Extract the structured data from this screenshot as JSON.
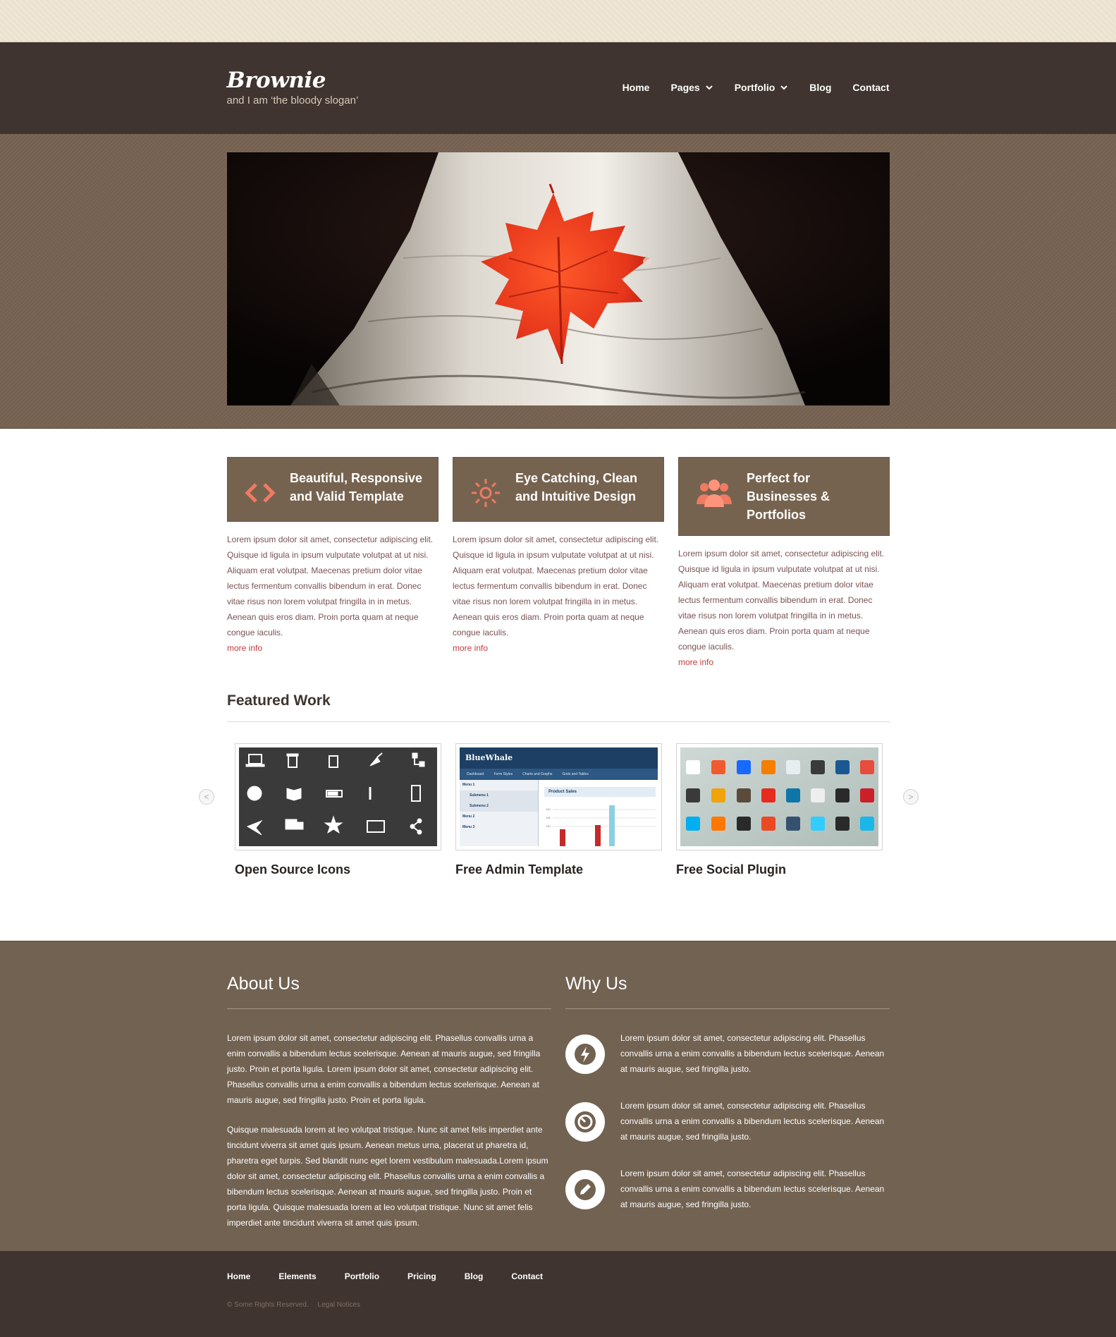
{
  "header": {
    "logo": "Brownie",
    "slogan": "and I am ‘the bloody slogan’",
    "nav": [
      "Home",
      "Pages",
      "Portfolio",
      "Blog",
      "Contact"
    ]
  },
  "features": [
    {
      "title_lines": [
        "Beautiful, Responsive",
        "and Valid Template"
      ],
      "icon": "code-icon",
      "text": "Lorem ipsum dolor sit amet, consectetur adipiscing elit. Quisque id ligula in ipsum vulputate volutpat at ut nisi. Aliquam erat volutpat. Maecenas pretium dolor vitae lectus fermentum convallis bibendum in erat. Donec vitae risus non lorem volutpat fringilla in in metus. Aenean quis eros diam. Proin porta quam at neque congue iaculis.",
      "more": "more info"
    },
    {
      "title_lines": [
        "Eye Catching, Clean",
        "and Intuitive Design"
      ],
      "icon": "sun-icon",
      "text": "Lorem ipsum dolor sit amet, consectetur adipiscing elit. Quisque id ligula in ipsum vulputate volutpat at ut nisi. Aliquam erat volutpat. Maecenas pretium dolor vitae lectus fermentum convallis bibendum in erat. Donec vitae risus non lorem volutpat fringilla in in metus. Aenean quis eros diam. Proin porta quam at neque congue iaculis.",
      "more": "more info"
    },
    {
      "title_lines": [
        "Perfect for",
        "Businesses &",
        "Portfolios"
      ],
      "icon": "users-icon",
      "text": "Lorem ipsum dolor sit amet, consectetur adipiscing elit. Quisque id ligula in ipsum vulputate volutpat at ut nisi. Aliquam erat volutpat. Maecenas pretium dolor vitae lectus fermentum convallis bibendum in erat. Donec vitae risus non lorem volutpat fringilla in in metus. Aenean quis eros diam. Proin porta quam at neque congue iaculis.",
      "more": "more info"
    }
  ],
  "featured_work": {
    "title": "Featured Work",
    "items": [
      {
        "title": "Open Source Icons"
      },
      {
        "title": "Free Admin Template",
        "mock_brand": "BlueWhale",
        "mock_tabs": [
          "Dashboard",
          "Form Styles",
          "Charts and Graphs",
          "Grids and Tables"
        ],
        "mock_menu": [
          "Menu 1",
          "Submenu 1",
          "Submenu 2",
          "Menu 2",
          "Menu 3"
        ],
        "mock_panel": "Product Sales",
        "mock_axis": [
          "140",
          "135",
          "130"
        ]
      },
      {
        "title": "Free Social Plugin"
      }
    ],
    "prev": "<",
    "next": ">"
  },
  "about": {
    "title": "About Us",
    "paragraphs": [
      "Lorem ipsum dolor sit amet, consectetur adipiscing elit. Phasellus convallis urna a enim convallis a bibendum lectus scelerisque. Aenean at mauris augue, sed fringilla justo. Proin et porta ligula. Lorem ipsum dolor sit amet, consectetur adipiscing elit. Phasellus convallis urna a enim convallis a bibendum lectus scelerisque. Aenean at mauris augue, sed fringilla justo. Proin et porta ligula.",
      "Quisque malesuada lorem at leo volutpat tristique. Nunc sit amet felis imperdiet ante tincidunt viverra sit amet quis ipsum. Aenean metus urna, placerat ut pharetra id, pharetra eget turpis. Sed blandit nunc eget lorem vestibulum malesuada.Lorem ipsum dolor sit amet, consectetur adipiscing elit. Phasellus convallis urna a enim convallis a bibendum lectus scelerisque. Aenean at mauris augue, sed fringilla justo. Proin et porta ligula. Quisque malesuada lorem at leo volutpat tristique. Nunc sit amet felis imperdiet ante tincidunt viverra sit amet quis ipsum."
    ]
  },
  "why": {
    "title": "Why Us",
    "items": [
      {
        "icon": "lightning-icon",
        "text": "Lorem ipsum dolor sit amet, consectetur adipiscing elit. Phasellus convallis urna a enim convallis a bibendum lectus scelerisque. Aenean at mauris augue, sed fringilla justo."
      },
      {
        "icon": "gauge-icon",
        "text": "Lorem ipsum dolor sit amet, consectetur adipiscing elit. Phasellus convallis urna a enim convallis a bibendum lectus scelerisque. Aenean at mauris augue, sed fringilla justo."
      },
      {
        "icon": "pencil-icon",
        "text": "Lorem ipsum dolor sit amet, consectetur adipiscing elit. Phasellus convallis urna a enim convallis a bibendum lectus scelerisque. Aenean at mauris augue, sed fringilla justo."
      }
    ]
  },
  "footer": {
    "nav": [
      "Home",
      "Elements",
      "Portfolio",
      "Pricing",
      "Blog",
      "Contact"
    ],
    "copyright": "© Some Rights Reserved.",
    "legal": "Legal Notices"
  },
  "colors": {
    "header": "#3f342f",
    "feature_box": "#76634f",
    "accent_icon": "#f07a62",
    "link": "#c43b3b",
    "footer": "#726252"
  }
}
